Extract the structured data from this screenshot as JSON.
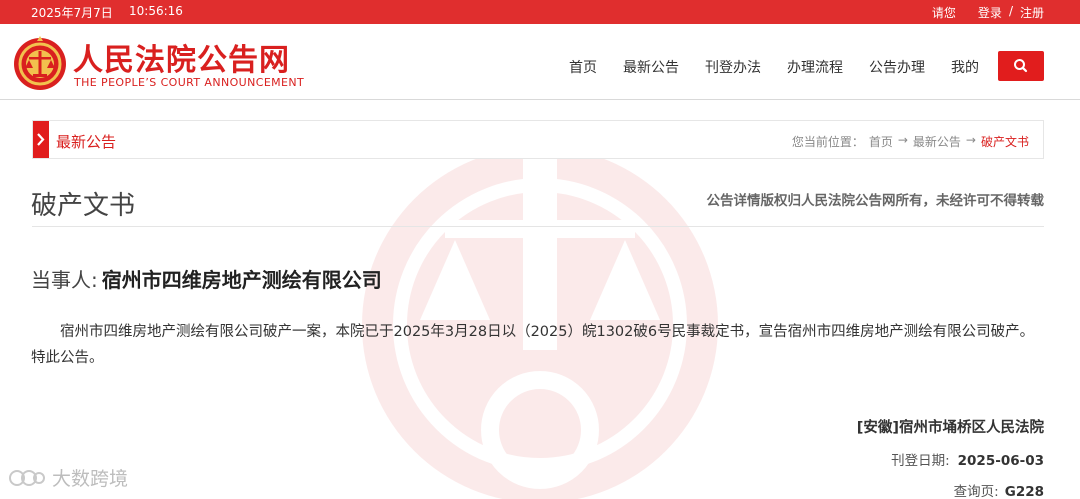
{
  "topbar": {
    "date": "2025年7月7日",
    "time": "10:56:16",
    "greeting": "请您",
    "login": "登录",
    "separator": "/",
    "register": "注册"
  },
  "logo": {
    "title_cn": "人民法院公告网",
    "title_en": "THE PEOPLE’S COURT ANNOUNCEMENT"
  },
  "nav": {
    "items": [
      "首页",
      "最新公告",
      "刊登办法",
      "办理流程",
      "公告办理",
      "我的"
    ]
  },
  "breadcrumb": {
    "section": "最新公告",
    "location_label": "您当前位置：",
    "home": "首页",
    "arrow": "→",
    "latest": "最新公告",
    "current": "破产文书"
  },
  "article": {
    "title": "破产文书",
    "copyright": "公告详情版权归人民法院公告网所有，未经许可不得转载",
    "party_label": "当事人:",
    "party_name": "宿州市四维房地产测绘有限公司",
    "body": "宿州市四维房地产测绘有限公司破产一案，本院已于2025年3月28日以（2025）皖1302破6号民事裁定书，宣告宿州市四维房地产测绘有限公司破产。特此公告。",
    "court": "[安徽]宿州市埇桥区人民法院",
    "pub_date_label": "刊登日期:",
    "pub_date": "2025-06-03",
    "query_label": "查询页:",
    "query_no": "G228"
  },
  "source_mark": {
    "text": "大数跨境"
  },
  "colors": {
    "brand_red": "#e02e2e",
    "text_red": "#d9201f"
  }
}
